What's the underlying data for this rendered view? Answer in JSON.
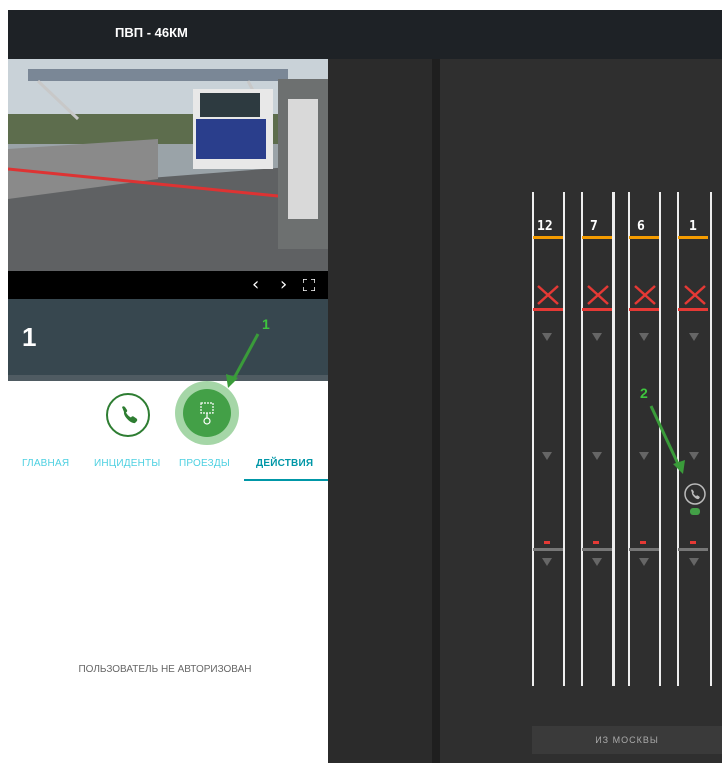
{
  "header": {
    "title": "ПВП - 46КМ"
  },
  "camera": {
    "prev_icon": "chevron-left-icon",
    "next_icon": "chevron-right-icon",
    "fullscreen_icon": "fullscreen-icon"
  },
  "lane": {
    "number": "1"
  },
  "actions": {
    "call_icon": "phone-icon",
    "pass_icon": "barrier-pass-icon"
  },
  "tabs": [
    {
      "label": "ГЛАВНАЯ"
    },
    {
      "label": "ИНЦИДЕНТЫ"
    },
    {
      "label": "ПРОЕЗДЫ"
    },
    {
      "label": "ДЕЙСТВИЯ",
      "active": true
    }
  ],
  "auth_message": "ПОЛЬЗОВАТЕЛЬ НЕ АВТОРИЗОВАН",
  "lanes_panel": {
    "lanes": [
      {
        "label": "12"
      },
      {
        "label": "7"
      },
      {
        "label": "6"
      },
      {
        "label": "1"
      }
    ],
    "direction_button": "ИЗ МОСКВЫ"
  },
  "annotations": [
    {
      "label": "1"
    },
    {
      "label": "2"
    }
  ],
  "colors": {
    "accent": "#0097a7",
    "green": "#43a047",
    "orange": "#f59c00",
    "red": "#e53935"
  }
}
